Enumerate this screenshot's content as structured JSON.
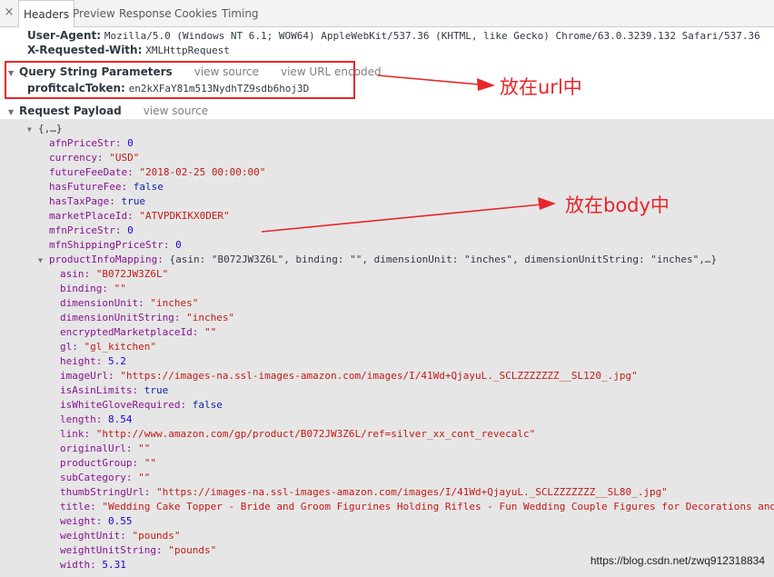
{
  "tabs": {
    "close_glyph": "×",
    "headers": "Headers",
    "preview": "Preview",
    "response": "Response",
    "cookies": "Cookies",
    "timing": "Timing"
  },
  "request_headers": [
    {
      "key": "User-Agent:",
      "value": "Mozilla/5.0 (Windows NT 6.1; WOW64) AppleWebKit/537.36 (KHTML, like Gecko) Chrome/63.0.3239.132 Safari/537.36"
    },
    {
      "key": "X-Requested-With:",
      "value": "XMLHttpRequest"
    }
  ],
  "query_section": {
    "title": "Query String Parameters",
    "view_source": "view source",
    "view_url_encoded": "view URL encoded",
    "param_key": "profitcalcToken:",
    "param_value": "en2kXFaY81m513NydhTZ9sdb6hoj3D"
  },
  "payload_section": {
    "title": "Request Payload",
    "view_source": "view source",
    "root": "{,…}",
    "fields": {
      "afnPriceStr": {
        "k": "afnPriceStr:",
        "v": "0"
      },
      "currency": {
        "k": "currency:",
        "v": "\"USD\""
      },
      "futureFeeDate": {
        "k": "futureFeeDate:",
        "v": "\"2018-02-25 00:00:00\""
      },
      "hasFutureFee": {
        "k": "hasFutureFee:",
        "v": "false"
      },
      "hasTaxPage": {
        "k": "hasTaxPage:",
        "v": "true"
      },
      "marketPlaceId": {
        "k": "marketPlaceId:",
        "v": "\"ATVPDKIKX0DER\""
      },
      "mfnPriceStr": {
        "k": "mfnPriceStr:",
        "v": "0"
      },
      "mfnShippingPriceStr": {
        "k": "mfnShippingPriceStr:",
        "v": "0"
      },
      "productInfoMapping": {
        "k": "productInfoMapping:",
        "v": "{asin: \"B072JW3Z6L\", binding: \"\", dimensionUnit: \"inches\", dimensionUnitString: \"inches\",…}"
      }
    },
    "product_fields": {
      "asin": {
        "k": "asin:",
        "v": "\"B072JW3Z6L\""
      },
      "binding": {
        "k": "binding:",
        "v": "\"\""
      },
      "dimensionUnit": {
        "k": "dimensionUnit:",
        "v": "\"inches\""
      },
      "dimensionUnitString": {
        "k": "dimensionUnitString:",
        "v": "\"inches\""
      },
      "encryptedMarketplaceId": {
        "k": "encryptedMarketplaceId:",
        "v": "\"\""
      },
      "gl": {
        "k": "gl:",
        "v": "\"gl_kitchen\""
      },
      "height": {
        "k": "height:",
        "v": "5.2"
      },
      "imageUrl": {
        "k": "imageUrl:",
        "v": "\"https://images-na.ssl-images-amazon.com/images/I/41Wd+QjayuL._SCLZZZZZZZ__SL120_.jpg\""
      },
      "isAsinLimits": {
        "k": "isAsinLimits:",
        "v": "true"
      },
      "isWhiteGloveRequired": {
        "k": "isWhiteGloveRequired:",
        "v": "false"
      },
      "length": {
        "k": "length:",
        "v": "8.54"
      },
      "link": {
        "k": "link:",
        "v": "\"http://www.amazon.com/gp/product/B072JW3Z6L/ref=silver_xx_cont_revecalc\""
      },
      "originalUrl": {
        "k": "originalUrl:",
        "v": "\"\""
      },
      "productGroup": {
        "k": "productGroup:",
        "v": "\"\""
      },
      "subCategory": {
        "k": "subCategory:",
        "v": "\"\""
      },
      "thumbStringUrl": {
        "k": "thumbStringUrl:",
        "v": "\"https://images-na.ssl-images-amazon.com/images/I/41Wd+QjayuL._SCLZZZZZZZ__SL80_.jpg\""
      },
      "title": {
        "k": "title:",
        "v": "\"Wedding Cake Topper - Bride and Groom Figurines Holding Rifles - Fun Wedding Couple Figures for Decorations and"
      },
      "weight": {
        "k": "weight:",
        "v": "0.55"
      },
      "weightUnit": {
        "k": "weightUnit:",
        "v": "\"pounds\""
      },
      "weightUnitString": {
        "k": "weightUnitString:",
        "v": "\"pounds\""
      },
      "width": {
        "k": "width:",
        "v": "5.31"
      }
    }
  },
  "annotations": {
    "url_note": "放在url中",
    "body_note": "放在body中",
    "color": "#e8262a"
  },
  "watermark": "https://blog.csdn.net/zwq912318834"
}
